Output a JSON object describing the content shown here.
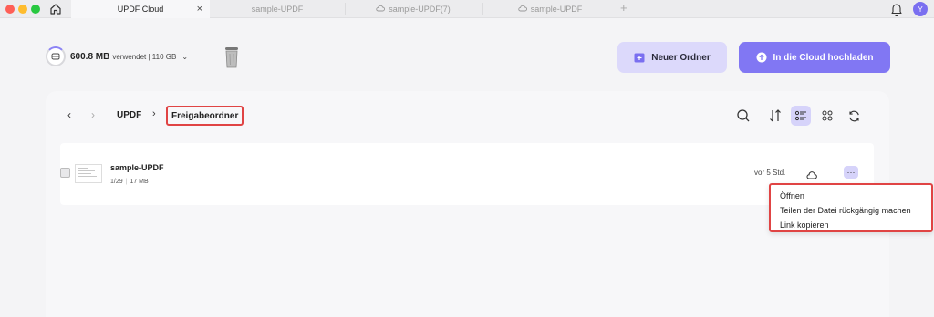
{
  "tabs": [
    {
      "label": "UPDF Cloud",
      "active": true,
      "close": "×"
    },
    {
      "label": "sample-UPDF",
      "active": false
    },
    {
      "label": "sample-UPDF(7)",
      "active": false,
      "icon": "cloud-icon"
    },
    {
      "label": "sample-UPDF",
      "active": false,
      "icon": "cloud-icon"
    }
  ],
  "tab_plus": "+",
  "avatar": "Y",
  "storage": {
    "used": "600.8 MB",
    "detail": "verwendet | 110 GB",
    "chevron": "⌄"
  },
  "toolbar": {
    "new_folder": "Neuer Ordner",
    "upload": "In die Cloud hochladen"
  },
  "nav": {
    "back": "‹",
    "forward": "›"
  },
  "breadcrumb": {
    "root": "UPDF",
    "separator": "›",
    "current": "Freigabeordner"
  },
  "file": {
    "name": "sample-UPDF",
    "pages": "1/29",
    "size": "17 MB",
    "time": "vor 5 Std.",
    "more": "···"
  },
  "context_menu": [
    "Öffnen",
    "Teilen der Datei rückgängig machen",
    "Link kopieren"
  ],
  "colors": {
    "accent": "#8177f3",
    "accent_light": "#d6d3fa",
    "highlight": "#e04444"
  }
}
